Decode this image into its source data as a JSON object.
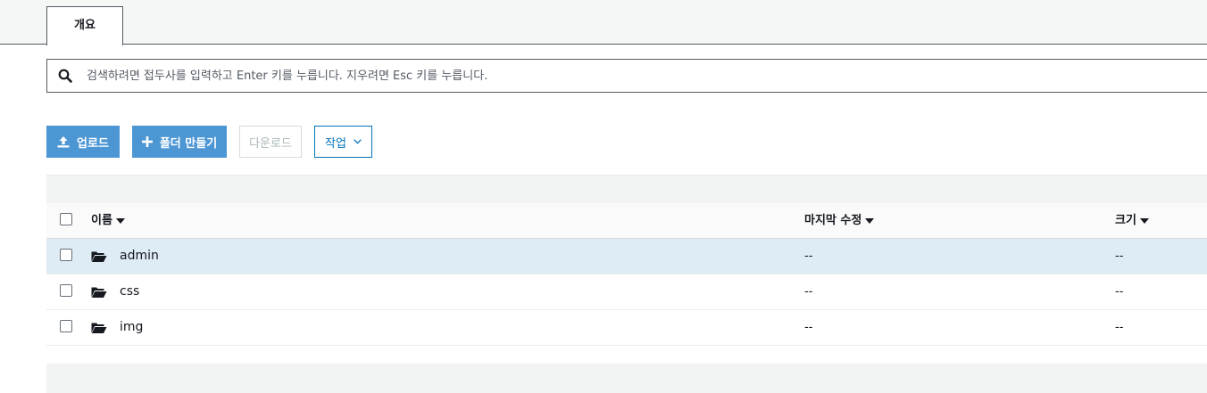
{
  "tabs": [
    {
      "label": "개요"
    }
  ],
  "search": {
    "placeholder": "검색하려면 접두사를 입력하고 Enter 키를 누릅니다. 지우려면 Esc 키를 누릅니다.",
    "value": "",
    "icon": "search-icon"
  },
  "toolbar": {
    "upload_label": "업로드",
    "create_folder_label": "폴더 만들기",
    "download_label": "다운로드",
    "actions_label": "작업"
  },
  "table": {
    "columns": [
      {
        "label": "이름"
      },
      {
        "label": "마지막 수정"
      },
      {
        "label": "크기"
      }
    ],
    "rows": [
      {
        "name": "admin",
        "modified": "--",
        "size": "--",
        "selected": true,
        "icon": "folder-open-icon"
      },
      {
        "name": "css",
        "modified": "--",
        "size": "--",
        "selected": false,
        "icon": "folder-open-icon"
      },
      {
        "name": "img",
        "modified": "--",
        "size": "--",
        "selected": false,
        "icon": "folder-open-icon"
      }
    ]
  },
  "colors": {
    "primary_button": "#4d96d4",
    "link_blue": "#0073bb",
    "selected_row": "#deecf6"
  }
}
